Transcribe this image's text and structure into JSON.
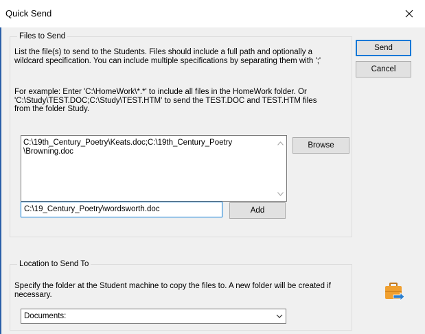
{
  "window": {
    "title": "Quick Send",
    "close_glyph": "✕"
  },
  "files_group": {
    "label": "Files to Send",
    "instructions": "List the file(s) to send to the Students. Files should include a full path and optionally a wildcard specification. You can include multiple specifications by separating them with ';'",
    "example": "For example: Enter 'C:\\HomeWork\\*.*' to include all files in the HomeWork folder. Or 'C:\\Study\\TEST.DOC;C:\\Study\\TEST.HTM' to send the TEST.DOC and TEST.HTM files from the folder Study.",
    "file_list": "C:\\19th_Century_Poetry\\Keats.doc;C:\\19th_Century_Poetry \\Browning.doc",
    "browse_label": "Browse",
    "input_value": "C:\\19_Century_Poetry\\wordsworth.doc",
    "add_label": "Add"
  },
  "buttons": {
    "send_label": "Send",
    "cancel_label": "Cancel"
  },
  "location_group": {
    "label": "Location to Send To",
    "instructions": "Specify the folder at the Student machine to copy the files to. A new folder will be created if necessary.",
    "selected": "Documents:"
  },
  "icons": {
    "briefcase": "briefcase-send-icon",
    "scroll_up": "▲",
    "scroll_down": "▼",
    "dropdown": "chevron-down-icon"
  },
  "colors": {
    "accent": "#0078d7",
    "window_bg": "#f0f0f0",
    "briefcase": "#f0a030",
    "arrow": "#2a7fd0"
  }
}
